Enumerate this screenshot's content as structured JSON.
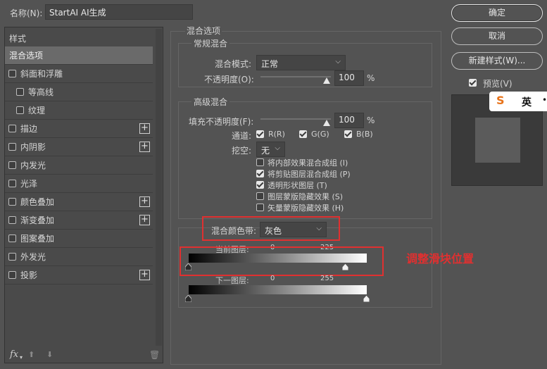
{
  "top": {
    "name_label": "名称(N):",
    "name_value": "StartAI AI生成"
  },
  "sidebar": {
    "header": "样式",
    "selected": "混合选项",
    "items": [
      {
        "label": "斜面和浮雕",
        "check": true,
        "plus": false,
        "indent": false
      },
      {
        "label": "等高线",
        "check": true,
        "plus": false,
        "indent": true
      },
      {
        "label": "纹理",
        "check": true,
        "plus": false,
        "indent": true
      },
      {
        "label": "描边",
        "check": true,
        "plus": true,
        "indent": false
      },
      {
        "label": "内阴影",
        "check": true,
        "plus": true,
        "indent": false
      },
      {
        "label": "内发光",
        "check": true,
        "plus": false,
        "indent": false
      },
      {
        "label": "光泽",
        "check": true,
        "plus": false,
        "indent": false
      },
      {
        "label": "颜色叠加",
        "check": true,
        "plus": true,
        "indent": false
      },
      {
        "label": "渐变叠加",
        "check": true,
        "plus": true,
        "indent": false
      },
      {
        "label": "图案叠加",
        "check": true,
        "plus": false,
        "indent": false
      },
      {
        "label": "外发光",
        "check": true,
        "plus": false,
        "indent": false
      },
      {
        "label": "投影",
        "check": true,
        "plus": true,
        "indent": false
      }
    ],
    "fx_label": "fx"
  },
  "blend": {
    "section_title": "混合选项",
    "general_title": "常规混合",
    "mode_label": "混合模式:",
    "mode_value": "正常",
    "opacity_label": "不透明度(O):",
    "opacity_value": "100",
    "percent": "%",
    "advanced_title": "高级混合",
    "fill_label": "填充不透明度(F):",
    "fill_value": "100",
    "channels_label": "通道:",
    "ch_r": "R(R)",
    "ch_g": "G(G)",
    "ch_b": "B(B)",
    "knockout_label": "挖空:",
    "knockout_value": "无",
    "opt1": "将内部效果混合成组 (I)",
    "opt2": "将剪贴图层混合成组 (P)",
    "opt3": "透明形状图层 (T)",
    "opt4": "图层蒙版隐藏效果 (S)",
    "opt5": "矢量蒙版隐藏效果 (H)",
    "blendif_label": "混合颜色带:",
    "blendif_value": "灰色",
    "this_layer_label": "当前图层:",
    "this_min": "0",
    "this_max": "225",
    "under_layer_label": "下一图层:",
    "under_min": "0",
    "under_max": "255",
    "annotation": "调整滑块位置",
    "this_layer_level": 225,
    "under_layer_level": 255
  },
  "buttons": {
    "ok": "确定",
    "cancel": "取消",
    "new_style": "新建样式(W)...",
    "preview": "预览(V)"
  },
  "ime": {
    "logo": "S",
    "lang": "英"
  },
  "colors": {
    "annotation_red": "#e03030",
    "accent": "#ffffff"
  }
}
